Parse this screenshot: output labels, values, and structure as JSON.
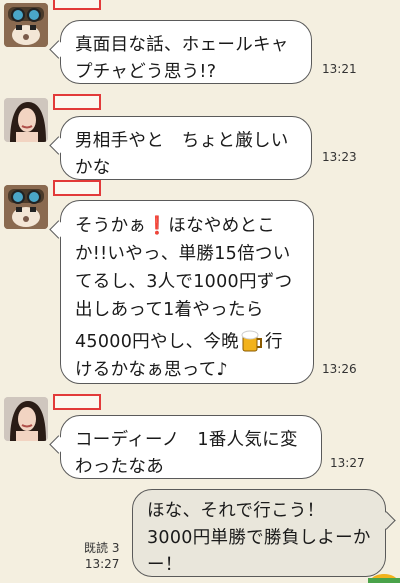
{
  "messages": [
    {
      "side": "left",
      "avatar_icon": "cartoon-man-goggles-avatar-icon",
      "lines": [
        "真面目な話、ホェールキャ",
        "プチャどう思う!?"
      ],
      "time": "13:21"
    },
    {
      "side": "left",
      "avatar_icon": "woman-photo-avatar-icon",
      "lines": [
        "男相手やと　ちょと厳しい",
        "かな"
      ],
      "time": "13:23"
    },
    {
      "side": "left",
      "avatar_icon": "cartoon-man-goggles-avatar-icon",
      "lines": [
        {
          "a": "そうかぁ",
          "b": "ほなやめとこ"
        },
        "か!!いやっ、単勝15倍つい",
        "てるし、3人で1000円ずつ",
        "出しあって1着やったら",
        {
          "a": "45000円やし、今晩",
          "b": "行"
        },
        "けるかなぁ思って♪"
      ],
      "time": "13:26"
    },
    {
      "side": "left",
      "avatar_icon": "woman-photo-avatar-icon",
      "lines": [
        "コーディーノ　1番人気に変",
        "わったなあ"
      ],
      "time": "13:27"
    },
    {
      "side": "right",
      "lines": [
        "ほな、それで行こう！",
        "3000円単勝で勝負しよーか",
        "ー！"
      ],
      "read": "既読 3",
      "time": "13:27"
    }
  ],
  "colors": {
    "background": "#f4efe0",
    "bubble_left": "#ffffff",
    "bubble_right": "#e9e6db",
    "name_redaction": "#e23a3a"
  }
}
